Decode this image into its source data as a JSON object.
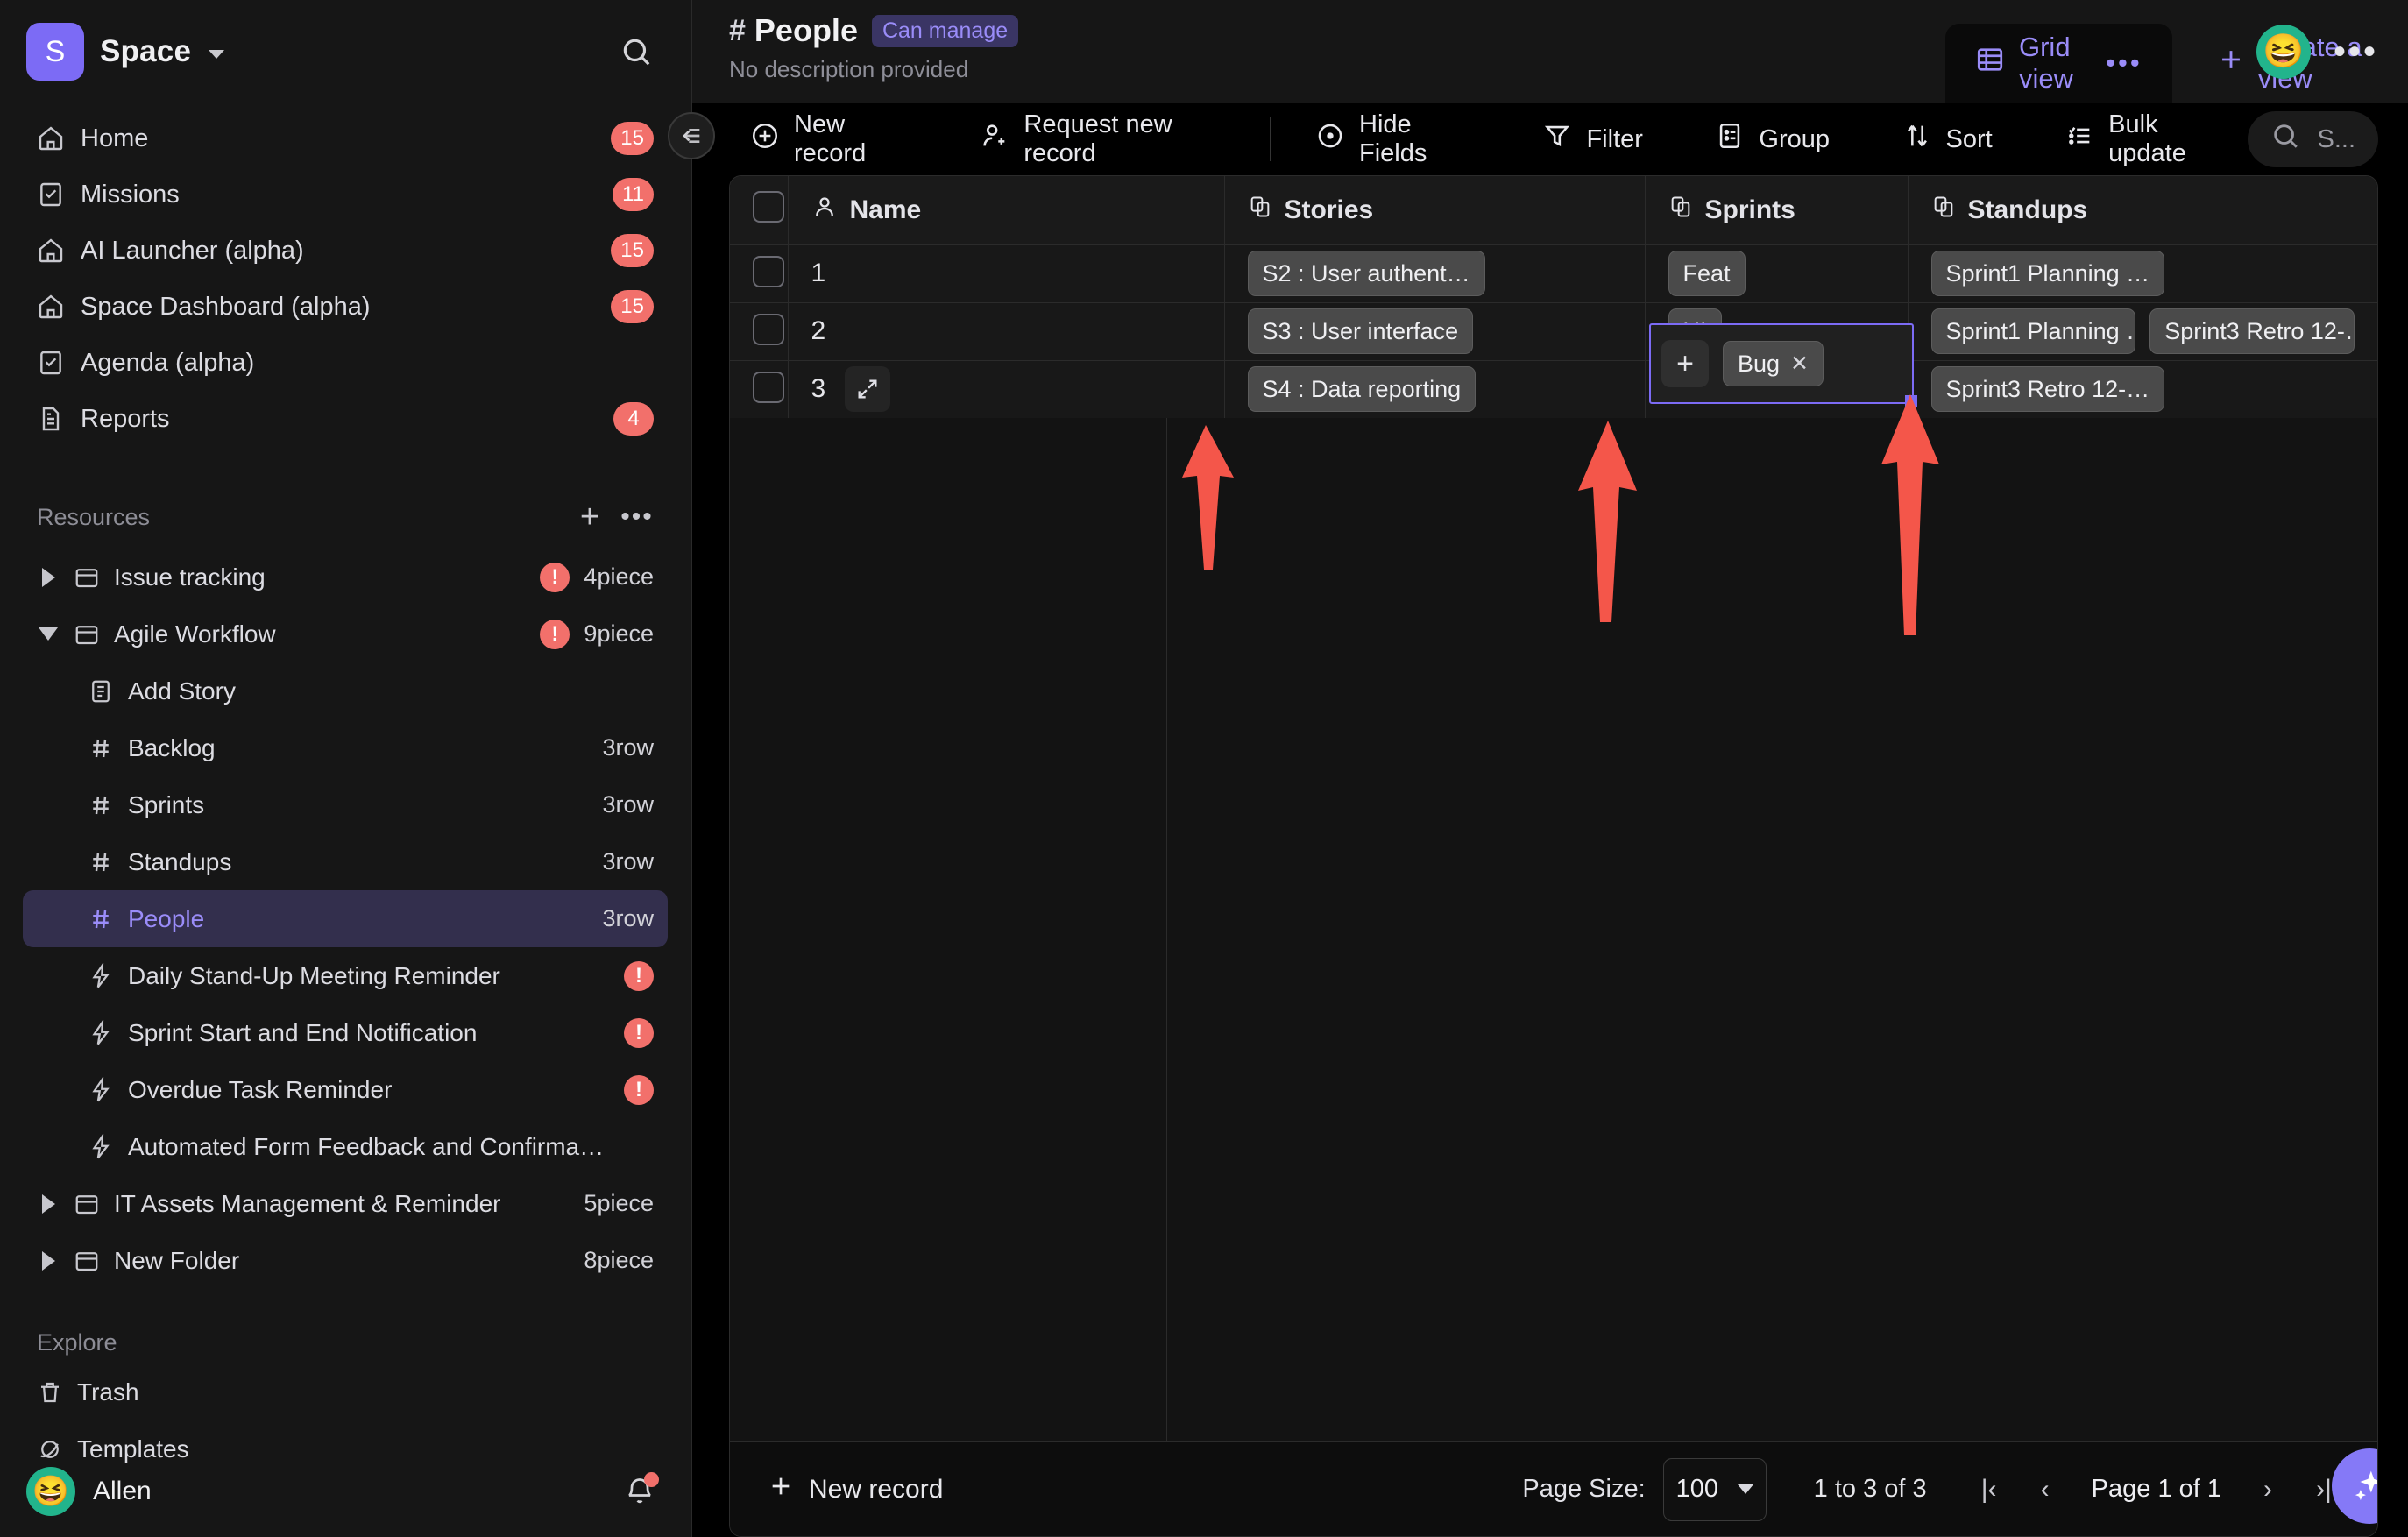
{
  "sidebar": {
    "space": {
      "initial": "S",
      "name": "Space"
    },
    "search_icon": "search-icon",
    "nav": [
      {
        "label": "Home",
        "icon": "home-icon",
        "badge": "15"
      },
      {
        "label": "Missions",
        "icon": "checkbox-icon",
        "badge": "11"
      },
      {
        "label": "AI Launcher (alpha)",
        "icon": "home-icon",
        "badge": "15"
      },
      {
        "label": "Space Dashboard (alpha)",
        "icon": "home-icon",
        "badge": "15"
      },
      {
        "label": "Agenda (alpha)",
        "icon": "checkbox-icon",
        "badge": ""
      },
      {
        "label": "Reports",
        "icon": "document-icon",
        "badge": "4"
      }
    ],
    "resources_title": "Resources",
    "tree": [
      {
        "label": "Issue tracking",
        "icon": "folder-icon",
        "caret": "right",
        "warn": true,
        "count": "4piece",
        "indent": 0,
        "selected": false
      },
      {
        "label": "Agile Workflow",
        "icon": "folder-icon",
        "caret": "down",
        "warn": true,
        "count": "9piece",
        "indent": 0,
        "selected": false
      },
      {
        "label": "Add Story",
        "icon": "form-icon",
        "caret": "none",
        "warn": false,
        "count": "",
        "indent": 1,
        "selected": false
      },
      {
        "label": "Backlog",
        "icon": "table-icon",
        "caret": "none",
        "warn": false,
        "count": "3row",
        "indent": 1,
        "selected": false
      },
      {
        "label": "Sprints",
        "icon": "table-icon",
        "caret": "none",
        "warn": false,
        "count": "3row",
        "indent": 1,
        "selected": false
      },
      {
        "label": "Standups",
        "icon": "table-icon",
        "caret": "none",
        "warn": false,
        "count": "3row",
        "indent": 1,
        "selected": false
      },
      {
        "label": "People",
        "icon": "table-icon",
        "caret": "none",
        "warn": false,
        "count": "3row",
        "indent": 1,
        "selected": true
      },
      {
        "label": "Daily Stand-Up Meeting Reminder",
        "icon": "bolt-icon",
        "caret": "none",
        "warn": true,
        "count": "",
        "indent": 1,
        "selected": false
      },
      {
        "label": "Sprint Start and End Notification",
        "icon": "bolt-icon",
        "caret": "none",
        "warn": true,
        "count": "",
        "indent": 1,
        "selected": false
      },
      {
        "label": "Overdue Task Reminder",
        "icon": "bolt-icon",
        "caret": "none",
        "warn": true,
        "count": "",
        "indent": 1,
        "selected": false
      },
      {
        "label": "Automated Form Feedback and Confirma…",
        "icon": "bolt-icon",
        "caret": "none",
        "warn": false,
        "count": "",
        "indent": 1,
        "selected": false
      },
      {
        "label": "IT Assets Management & Reminder",
        "icon": "folder-icon",
        "caret": "right",
        "warn": false,
        "count": "5piece",
        "indent": 0,
        "selected": false
      },
      {
        "label": "New Folder",
        "icon": "folder-icon",
        "caret": "right",
        "warn": false,
        "count": "8piece",
        "indent": 0,
        "selected": false
      }
    ],
    "explore_title": "Explore",
    "explore": [
      {
        "label": "Trash",
        "icon": "trash-icon"
      },
      {
        "label": "Templates",
        "icon": "planet-icon"
      }
    ],
    "user": {
      "name": "Allen",
      "avatar": "😆",
      "notification_dot": true
    }
  },
  "header": {
    "hash": "#",
    "title": "People",
    "permission": "Can manage",
    "description": "No description provided",
    "tabs": [
      {
        "label": "Grid view",
        "icon": "grid-icon",
        "dots": "•••",
        "active": true
      }
    ],
    "create_view_label": "Create a view",
    "avatar": "😆",
    "more": "•••"
  },
  "toolbar": {
    "buttons": [
      {
        "label": "New record",
        "icon": "plus-circle-icon"
      },
      {
        "label": "Request new record",
        "icon": "person-plus-icon"
      },
      {
        "label": "Hide Fields",
        "icon": "eye-icon"
      },
      {
        "label": "Filter",
        "icon": "funnel-icon"
      },
      {
        "label": "Group",
        "icon": "group-icon"
      },
      {
        "label": "Sort",
        "icon": "sort-icon"
      },
      {
        "label": "Bulk update",
        "icon": "list-check-icon"
      }
    ],
    "search": {
      "icon": "search-icon",
      "placeholder": "S..."
    }
  },
  "grid": {
    "columns": [
      {
        "label": "Name",
        "icon": "person-icon"
      },
      {
        "label": "Stories",
        "icon": "link-record-icon"
      },
      {
        "label": "Sprints",
        "icon": "link-record-icon"
      },
      {
        "label": "Standups",
        "icon": "link-record-icon"
      }
    ],
    "rows": [
      {
        "num": "1",
        "stories": [
          "S2 : User authent…"
        ],
        "sprints": [
          "Feat"
        ],
        "standups": [
          "Sprint1 Planning …"
        ]
      },
      {
        "num": "2",
        "stories": [
          "S3 : User interface"
        ],
        "sprints": [
          "UI"
        ],
        "standups": [
          "Sprint1 Planning …",
          "Sprint3 Retro 12-…"
        ]
      },
      {
        "num": "3",
        "stories": [
          "S4 : Data reporting"
        ],
        "sprints": [],
        "standups": [
          "Sprint3 Retro 12-…"
        ]
      }
    ],
    "editing_cell": {
      "plus": "+",
      "chip": "Bug",
      "remove": "✕"
    }
  },
  "footer": {
    "new_record_label": "New record",
    "page_size_label": "Page Size:",
    "page_size_value": "100",
    "range": "1 to 3 of 3",
    "page_label": "Page 1 of 1",
    "first": "|‹",
    "prev": "‹",
    "next": "›",
    "last": "›|"
  },
  "annotations": {
    "arrow_color": "#f4564a",
    "arrows": [
      {
        "name": "arrow-stories-cell"
      },
      {
        "name": "arrow-sprints-cell"
      },
      {
        "name": "arrow-standups-cell"
      }
    ]
  },
  "colors": {
    "accent": "#7c6bf5",
    "accent_text": "#9a8cf8",
    "badge_red": "#f2706b",
    "avatar_green": "#22b48c"
  }
}
